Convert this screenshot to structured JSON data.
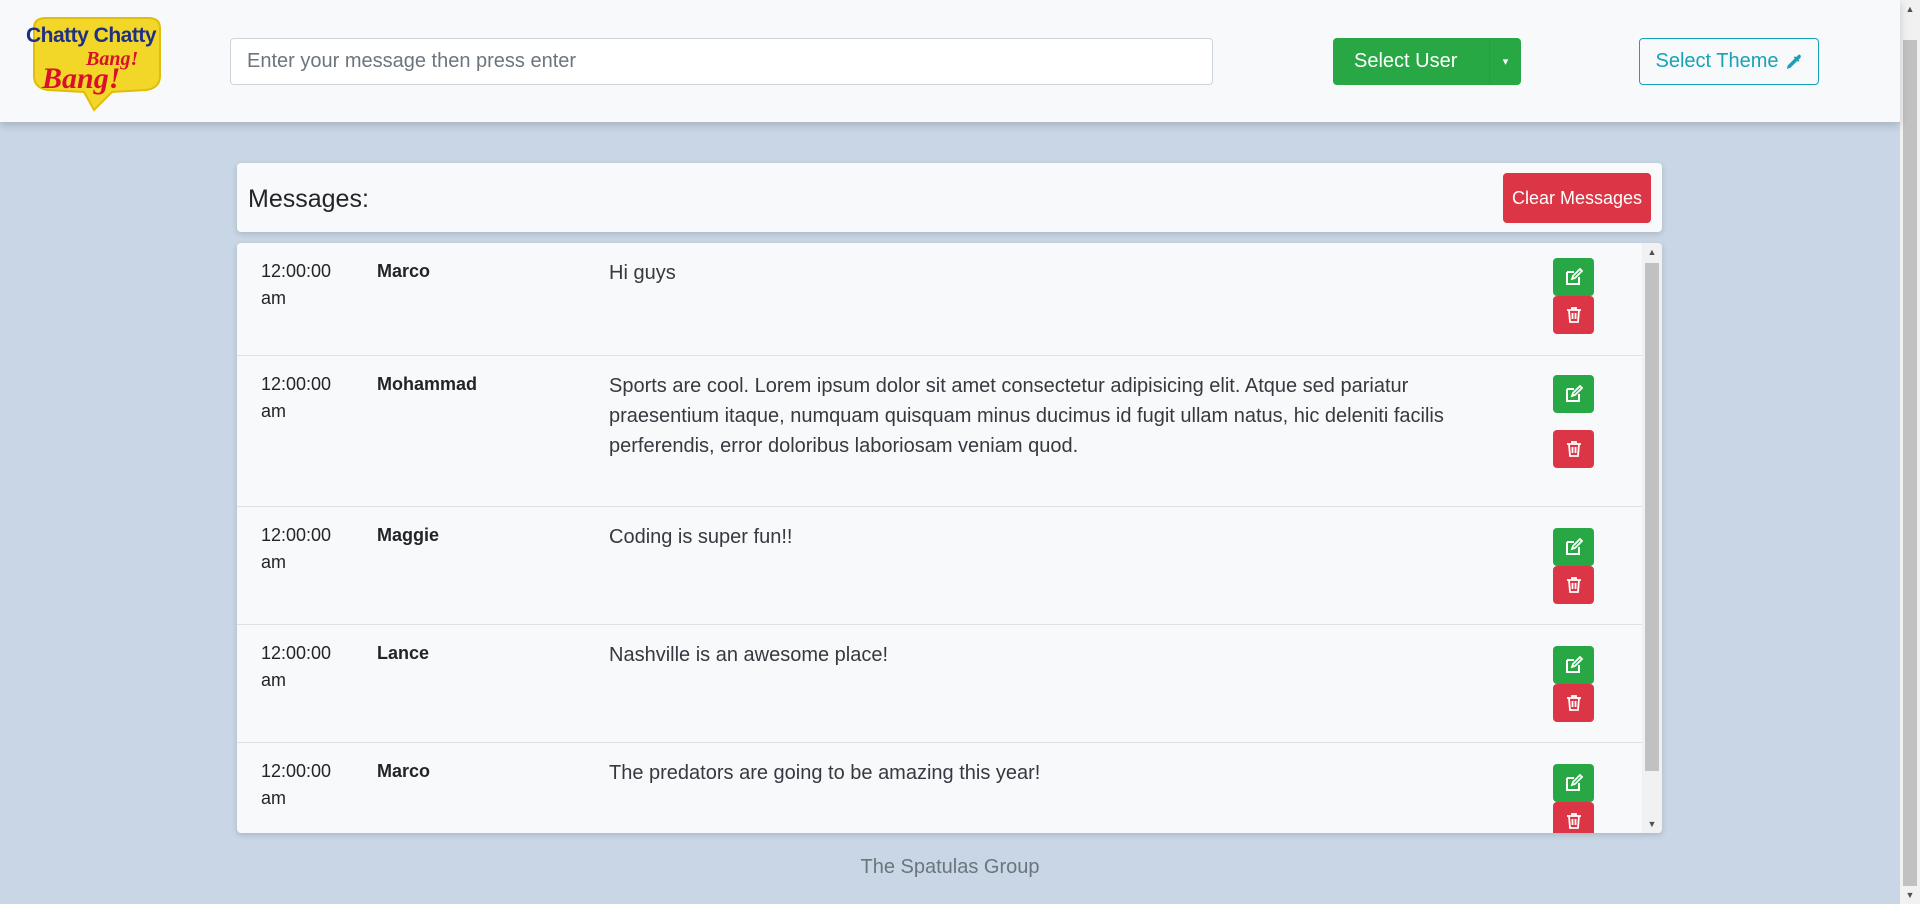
{
  "header": {
    "logo": {
      "line1": "Chatty Chatty",
      "line2": "Bang!",
      "line3": "Bang!"
    },
    "message_input": {
      "placeholder": "Enter your message then press enter",
      "value": ""
    },
    "select_user": {
      "label": "Select User",
      "caret": "▾"
    },
    "select_theme": {
      "label": "Select Theme",
      "icon": "eyedropper-icon"
    }
  },
  "messages_panel": {
    "title": "Messages:",
    "clear_label": "Clear Messages"
  },
  "messages": [
    {
      "time": "12:00:00 am",
      "user": "Marco",
      "text": "Hi guys"
    },
    {
      "time": "12:00:00 am",
      "user": "Mohammad",
      "text": "Sports are cool. Lorem ipsum dolor sit amet consectetur adipisicing elit. Atque sed pariatur praesentium itaque, numquam quisquam minus ducimus id fugit ullam natus, hic deleniti facilis perferendis, error doloribus laboriosam veniam quod."
    },
    {
      "time": "12:00:00 am",
      "user": "Maggie",
      "text": "Coding is super fun!!"
    },
    {
      "time": "12:00:00 am",
      "user": "Lance",
      "text": "Nashville is an awesome place!"
    },
    {
      "time": "12:00:00 am",
      "user": "Marco",
      "text": "The predators are going to be amazing this year!"
    }
  ],
  "row_actions": {
    "edit_icon": "edit-icon",
    "delete_icon": "trash-icon"
  },
  "footer": {
    "text": "The Spatulas Group"
  },
  "colors": {
    "background": "#c8d6e5",
    "success": "#28a745",
    "danger": "#dc3545",
    "info": "#17a2b8"
  }
}
